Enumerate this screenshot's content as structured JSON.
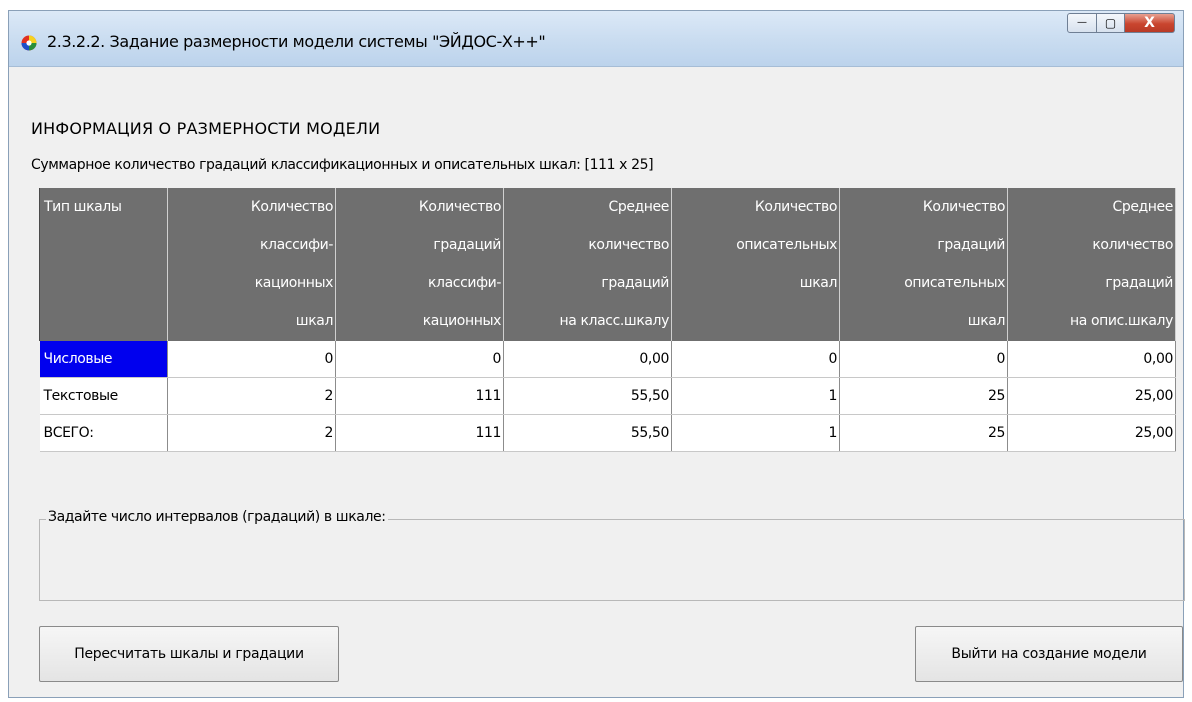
{
  "window": {
    "title": "2.3.2.2. Задание размерности модели системы \"ЭЙДОС-X++\"",
    "buttons": {
      "minimize": "—",
      "maximize": "▢",
      "close": "X"
    }
  },
  "main": {
    "heading": "ИНФОРМАЦИЯ О РАЗМЕРНОСТИ МОДЕЛИ",
    "summary": "Суммарное количество градаций классификационных и описательных шкал: [111 x 25]"
  },
  "table": {
    "headers": [
      [
        "Тип шкалы"
      ],
      [
        "Количество",
        "классифи-",
        "кационных",
        "шкал"
      ],
      [
        "Количество",
        "градаций",
        "классифи-",
        "кационных"
      ],
      [
        "Среднее",
        "количество",
        "градаций",
        "на класс.шкалу"
      ],
      [
        "Количество",
        "описательных",
        "шкал"
      ],
      [
        "Количество",
        "градаций",
        "описательных",
        "шкал"
      ],
      [
        "Среднее",
        "количество",
        "градаций",
        "на опис.шкалу"
      ]
    ],
    "rows": [
      [
        "Числовые",
        "0",
        "0",
        "0,00",
        "0",
        "0",
        "0,00"
      ],
      [
        "Текстовые",
        "2",
        "111",
        "55,50",
        "1",
        "25",
        "25,00"
      ],
      [
        "ВСЕГО:",
        "2",
        "111",
        "55,50",
        "1",
        "25",
        "25,00"
      ]
    ]
  },
  "group": {
    "label": "Задайте число интервалов (градаций) в шкале:"
  },
  "footer": {
    "recalc_label": "Пересчитать шкалы и градации",
    "exit_label": "Выйти на создание модели"
  }
}
